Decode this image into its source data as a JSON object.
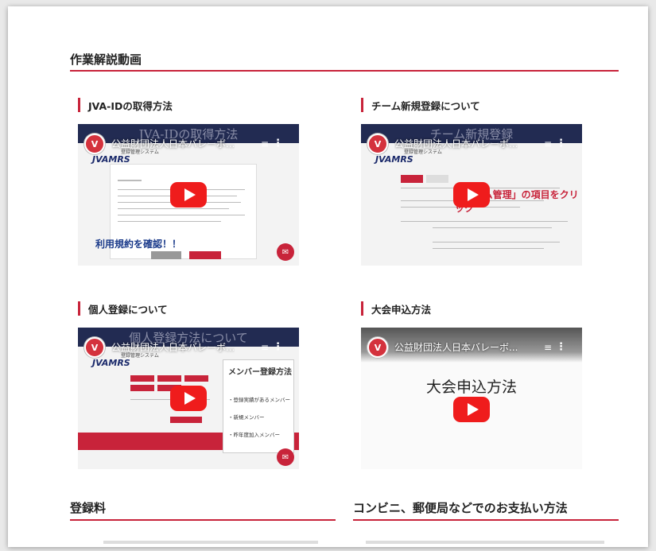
{
  "section": {
    "title": "作業解説動画"
  },
  "videos": [
    {
      "heading": "JVA-IDの取得方法",
      "video_title_overlay": "JVA-IDの取得方法",
      "channel": "公益財団法人日本バレーボ...",
      "overlay_text": "利用規約を確認！！"
    },
    {
      "heading": "チーム新規登録について",
      "video_title_overlay": "チーム新規登録",
      "channel": "公益財団法人日本バレーボ...",
      "overlay_text": "「チーム管理」の項目をクリック"
    },
    {
      "heading": "個人登録について",
      "video_title_overlay": "個人登録方法について",
      "channel": "公益財団法人日本バレーボ...",
      "menu_title": "メンバー登録方法",
      "menu_items": [
        "・登録実績があるメンバー",
        "・新規メンバー",
        "・昨年度加入メンバー"
      ]
    },
    {
      "heading": "大会申込方法",
      "channel": "公益財団法人日本バレーボ...",
      "slide_title": "大会申込方法"
    }
  ],
  "bottom": {
    "left_title": "登録料",
    "right_title": "コンビニ、郵便局などでのお支払い方法"
  },
  "brand": "JVAMRS",
  "colors": {
    "accent": "#c8233a",
    "play": "#ef1c1c",
    "banner": "#222b52"
  }
}
